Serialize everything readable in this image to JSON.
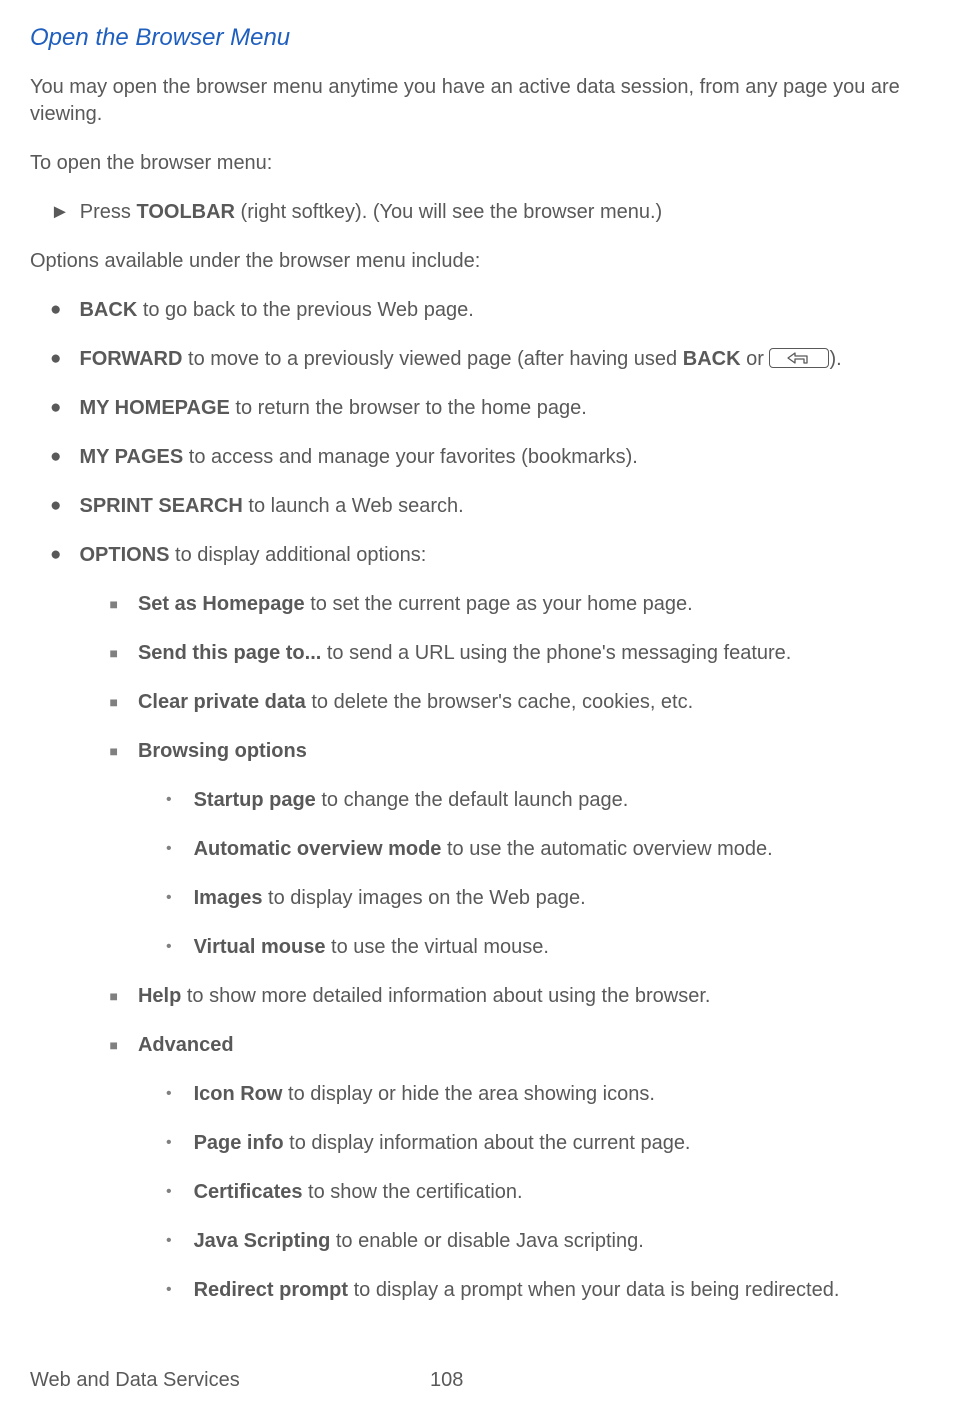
{
  "heading": "Open the Browser Menu",
  "intro": "You may open the browser menu anytime you have an active data session, from any page you are viewing.",
  "open_prompt": "To open the browser menu:",
  "arrow": {
    "pre": "Press ",
    "bold": "TOOLBAR",
    "post": " (right softkey). (You will see the browser menu.)"
  },
  "options_prompt": "Options available under the browser menu include:",
  "bullets": {
    "back": {
      "b": "BACK",
      "t": " to go back to the previous Web page."
    },
    "forward": {
      "b1": "FORWARD",
      "t1": " to move to a previously viewed page (after having used ",
      "b2": "BACK",
      "t2": " or ",
      "t3": ")."
    },
    "homepage": {
      "b": "MY HOMEPAGE",
      "t": " to return the browser to the home page."
    },
    "mypages": {
      "b": "MY PAGES",
      "t": " to access and manage your favorites (bookmarks)."
    },
    "search": {
      "b": "SPRINT SEARCH",
      "t": " to launch a Web search."
    },
    "options": {
      "b": "OPTIONS",
      "t": " to display additional options:"
    }
  },
  "squares": {
    "sethome": {
      "b": "Set as Homepage",
      "t": " to set the current page as your home page."
    },
    "send": {
      "b": "Send this page to...",
      "t": " to send a URL using the phone's messaging feature."
    },
    "clear": {
      "b": "Clear private data",
      "t": " to delete the browser's cache, cookies, etc."
    },
    "browsing": {
      "b": "Browsing options"
    },
    "help": {
      "b": "Help",
      "t": " to show more detailed information about using the browser."
    },
    "advanced": {
      "b": "Advanced"
    }
  },
  "browsing_dash": {
    "startup": {
      "b": "Startup page",
      "t": " to change the default launch page."
    },
    "overview": {
      "b": "Automatic overview mode",
      "t": " to use the automatic overview mode."
    },
    "images": {
      "b": "Images",
      "t": " to display images on the Web page."
    },
    "vmouse": {
      "b": "Virtual mouse",
      "t": " to use the virtual mouse."
    }
  },
  "advanced_dash": {
    "iconrow": {
      "b": "Icon Row",
      "t": " to display or hide the area showing icons."
    },
    "pageinfo": {
      "b": "Page info",
      "t": " to display information about the current page."
    },
    "certs": {
      "b": "Certificates",
      "t": " to show the certification."
    },
    "js": {
      "b": "Java Scripting",
      "t": " to enable or disable Java scripting."
    },
    "redirect": {
      "b": "Redirect prompt",
      "t": " to display a prompt when your data is being redirected."
    }
  },
  "footer": {
    "section": "Web and Data Services",
    "page": "108"
  }
}
